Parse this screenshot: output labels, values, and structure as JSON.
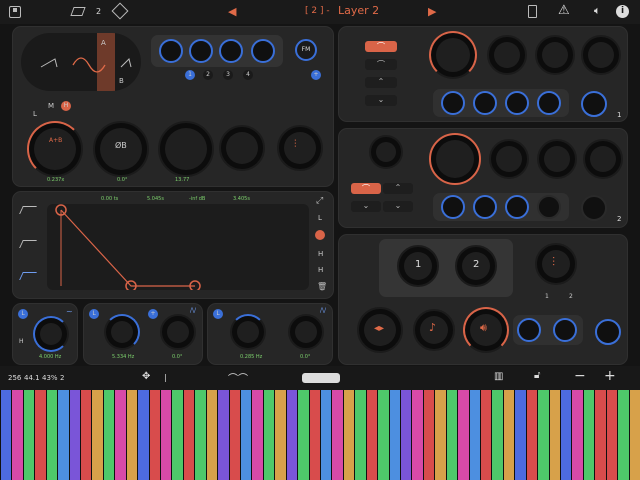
{
  "top_bar": {
    "layer_count": "2",
    "layer_title_prefix": "[ 2 ] -",
    "layer_title": "Layer 2"
  },
  "osc": {
    "label_a": "A",
    "label_b": "B",
    "voices": [
      "1",
      "2",
      "3",
      "4"
    ],
    "fm_label": "FM",
    "lmh": [
      "L",
      "M",
      "H"
    ],
    "knob_ab_label": "A+B",
    "value_ab": "0.237x",
    "value_phase": "0.0°",
    "value_three": "13.77"
  },
  "envelope": {
    "times": [
      "0.00 ts",
      "5.045s",
      "-inf dB",
      "3.405s"
    ],
    "side_buttons": [
      "L",
      "H",
      "H"
    ]
  },
  "lfo": [
    {
      "value_a": "4.000 Hz"
    },
    {
      "value_a": "5.334 Hz",
      "value_b": "0.0°"
    },
    {
      "value_a": "0.285 Hz",
      "value_b": "0.0°"
    }
  ],
  "right": {
    "section1_number": "1",
    "section2_number": "2",
    "pad_labels": [
      "1",
      "2"
    ],
    "mini_labels": [
      "1",
      "2"
    ]
  },
  "status": {
    "polyphony": "256",
    "sample_rate": "44.1",
    "cpu": "43%",
    "voices": "2",
    "sep": "|"
  },
  "keyboard": {
    "colors": [
      "#4d6be0",
      "#d74aa8",
      "#4ec86a",
      "#d84c4c",
      "#4ec86a",
      "#4d8fe0",
      "#7a55d8",
      "#d84c4c",
      "#d7a14a",
      "#4ec86a",
      "#d74aa8",
      "#d7a14a",
      "#4d6be0",
      "#d84c4c",
      "#d74aa8",
      "#4ec86a",
      "#d84c4c",
      "#4ec86a",
      "#d7a14a",
      "#7a55d8",
      "#d84c4c",
      "#4d8fe0",
      "#d74aa8",
      "#4ec86a",
      "#d7a14a",
      "#7a55d8",
      "#4ec86a",
      "#d84c4c",
      "#4d8fe0",
      "#d74aa8",
      "#d7a14a",
      "#4ec86a",
      "#d84c4c",
      "#4ec86a",
      "#4d8fe0",
      "#7a55d8",
      "#d74aa8",
      "#d84c4c",
      "#d7a14a",
      "#4ec86a",
      "#d74aa8",
      "#4d8fe0",
      "#d84c4c",
      "#4ec86a",
      "#d7a14a",
      "#4d6be0",
      "#d84c4c",
      "#4ec86a",
      "#d7a14a",
      "#4d6be0",
      "#d74aa8",
      "#4ec86a",
      "#d84c4c",
      "#d84c4c",
      "#4ec86a",
      "#d7a14a"
    ]
  }
}
